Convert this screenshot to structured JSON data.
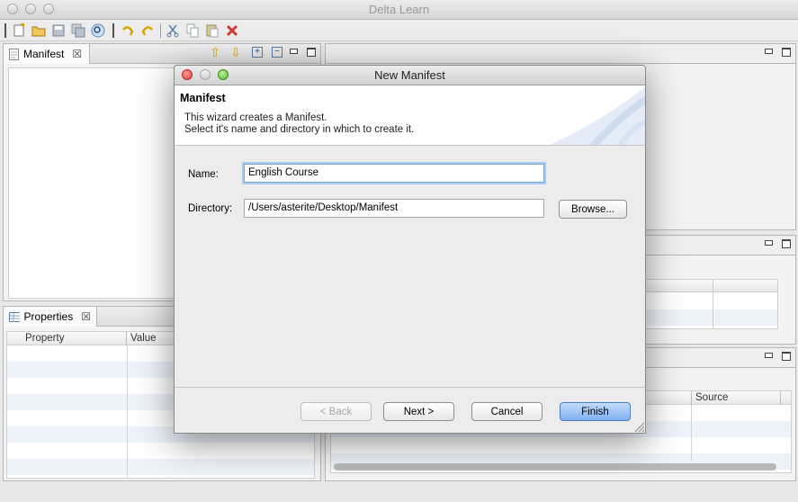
{
  "app": {
    "title": "Delta Learn"
  },
  "toolbar": {
    "icons": [
      "new-file-icon",
      "open-folder-icon",
      "save-icon",
      "save-all-icon",
      "search-icon",
      "undo-icon",
      "redo-icon",
      "cut-icon",
      "copy-icon",
      "paste-icon",
      "delete-icon"
    ]
  },
  "manifest_view": {
    "tab_label": "Manifest"
  },
  "properties_view": {
    "tab_label": "Properties",
    "col_property": "Property",
    "col_value": "Value"
  },
  "bottom_right_view": {
    "col_source": "Source"
  },
  "dialog": {
    "title": "New Manifest",
    "header_title": "Manifest",
    "desc_line1": "This wizard creates a Manifest.",
    "desc_line2": "Select it's name and directory in which to create it.",
    "name_label": "Name:",
    "name_value": "English Course",
    "directory_label": "Directory:",
    "directory_value": "/Users/asterite/Desktop/Manifest",
    "browse_label": "Browse...",
    "back_label": "< Back",
    "next_label": "Next >",
    "cancel_label": "Cancel",
    "finish_label": "Finish"
  },
  "colors": {
    "default_button": "#7fb1f0",
    "accent": "#4b7fc2"
  }
}
